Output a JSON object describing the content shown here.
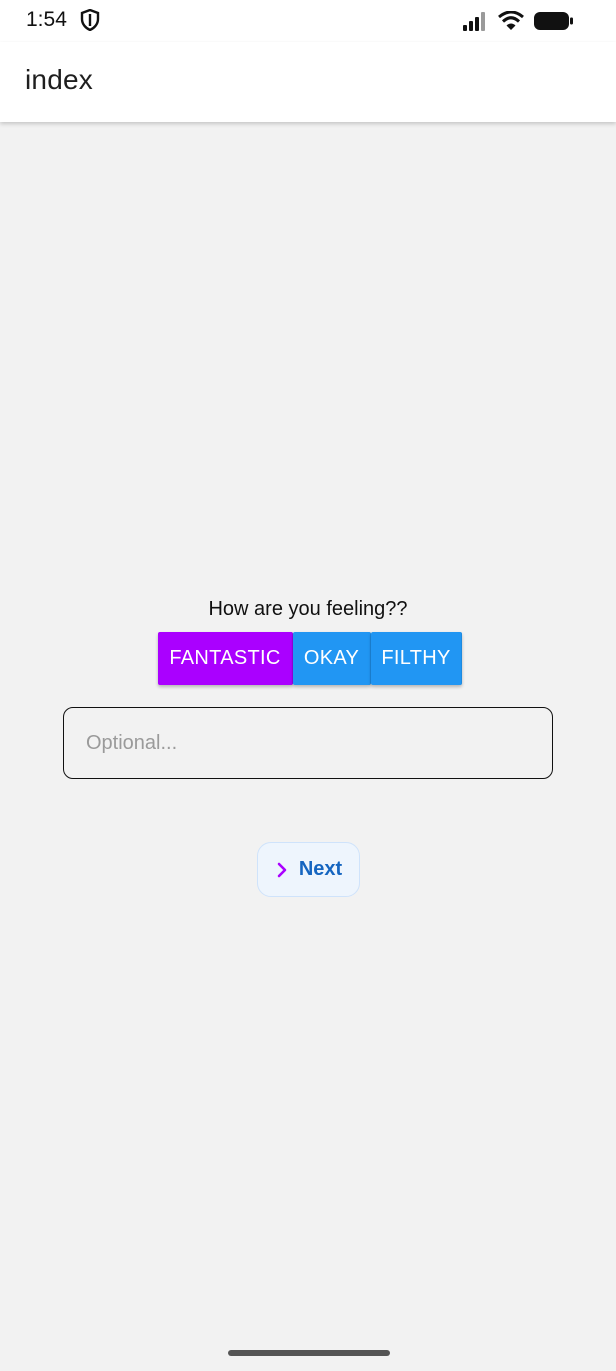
{
  "status_bar": {
    "time": "1:54",
    "icons": [
      "shield-icon",
      "signal-icon",
      "wifi-icon",
      "battery-icon"
    ]
  },
  "app_bar": {
    "title": "index"
  },
  "main": {
    "question": "How are you feeling??",
    "choices": [
      {
        "label": "FANTASTIC",
        "color": "#aa00ff",
        "selected": true
      },
      {
        "label": "OKAY",
        "color": "#2196f3",
        "selected": false
      },
      {
        "label": "FILTHY",
        "color": "#2196f3",
        "selected": false
      }
    ],
    "note_input": {
      "value": "",
      "placeholder": "Optional..."
    },
    "next_button": {
      "label": "Next",
      "icon": "chevron-right-icon",
      "icon_color": "#aa00ff",
      "label_color": "#1565c0"
    }
  },
  "colors": {
    "accent_selected": "#aa00ff",
    "accent_default": "#2196f3",
    "background": "#f2f2f2"
  }
}
